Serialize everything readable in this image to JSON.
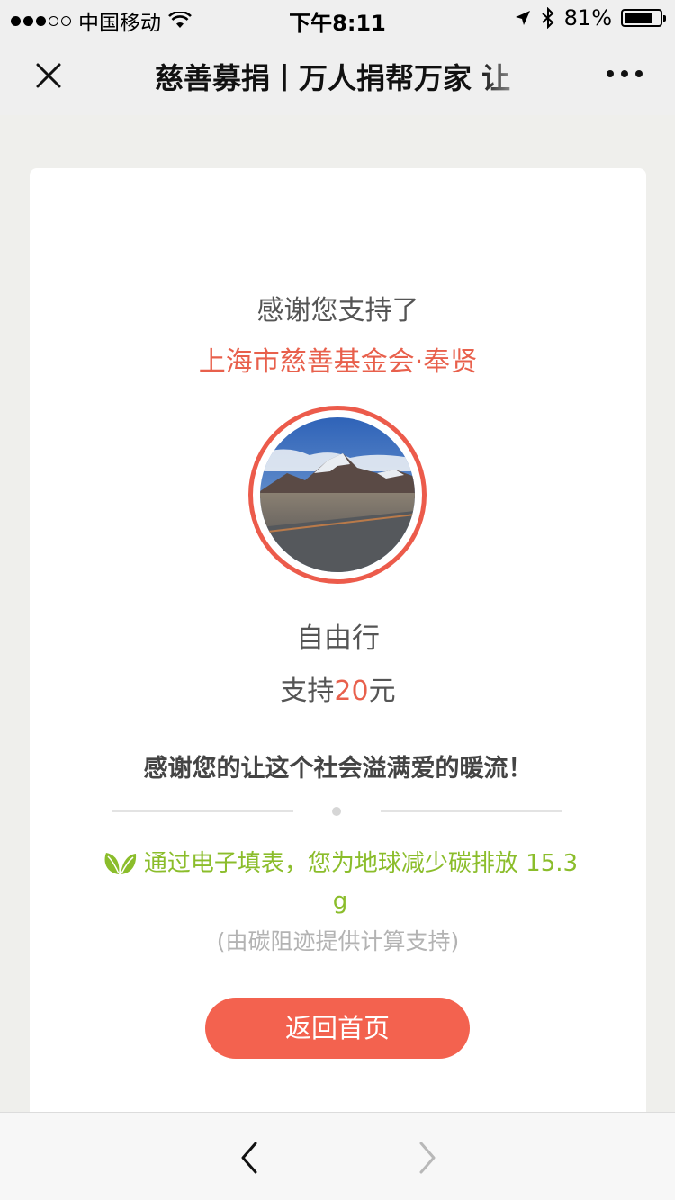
{
  "status_bar": {
    "carrier": "中国移动",
    "time": "下午8:11",
    "battery": "81%",
    "battery_level": 0.81,
    "signal_bars_filled": 3,
    "signal_bars_total": 5
  },
  "nav": {
    "title": "慈善募捐丨万人捐帮万家 让"
  },
  "card": {
    "thanks_text": "感谢您支持了",
    "org_name": "上海市慈善基金会·奉贤",
    "nickname": "自由行",
    "amount_prefix": "支持",
    "amount_value": "20",
    "amount_unit": "元",
    "blessing": "感谢您的让这个社会溢满爱的暖流！",
    "eco_text": "通过电子填表，您为地球减少碳排放 15.3 g",
    "eco_note": "(由碳阻迹提供计算支持)",
    "home_button": "返回首页"
  },
  "colors": {
    "accent": "#e8604c",
    "button": "#f3624f",
    "eco_green": "#8bbd2b"
  },
  "icons": {
    "close": "close-icon",
    "more": "more-icon",
    "leaf": "leaf-icon",
    "back": "chevron-left-icon",
    "forward": "chevron-right-icon"
  }
}
